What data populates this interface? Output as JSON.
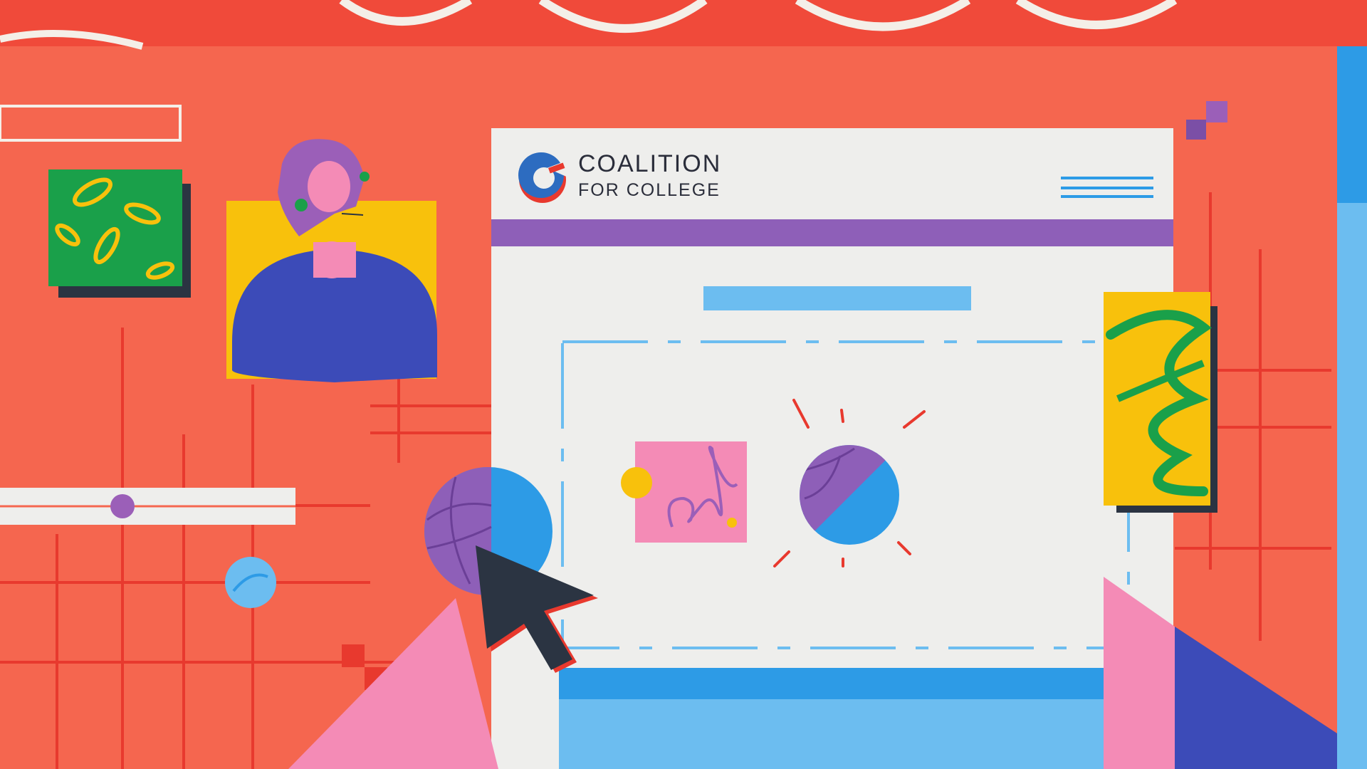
{
  "brand": {
    "name_line1": "COALITION",
    "name_line2": "FOR COLLEGE",
    "logo_icon": "coalition-c-logo"
  },
  "colors": {
    "background_coral": "#f5664f",
    "top_band_red": "#f04a3a",
    "browser_panel": "#eeeeec",
    "nav_bar_purple": "#8e5fb8",
    "accent_blue": "#6cbdf0",
    "deep_blue": "#2d9be6",
    "pink": "#f48bb6",
    "yellow": "#f8c10c",
    "green": "#1aa04a",
    "navy": "#3c4bb8",
    "cursor_dark": "#2b3442"
  },
  "icons": [
    "hamburger-menu-icon",
    "cursor-arrow-icon",
    "sphere-icon",
    "pink-image-card-icon",
    "person-avatar-icon"
  ]
}
